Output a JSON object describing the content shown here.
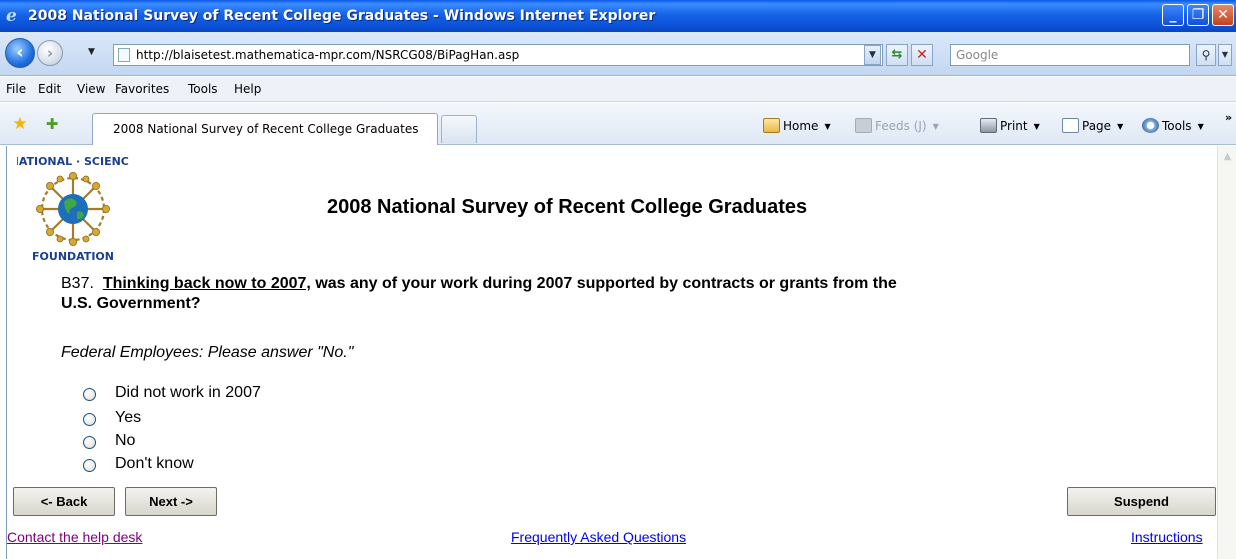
{
  "window": {
    "title": "2008 National Survey of Recent College Graduates - Windows Internet Explorer",
    "controls": {
      "minimize": "_",
      "maximize": "❐",
      "close": "✕"
    }
  },
  "address_bar": {
    "url": "http://blaisetest.mathematica-mpr.com/NSRCG08/BiPagHan.asp",
    "search_placeholder": "Google"
  },
  "menu": {
    "items": [
      "File",
      "Edit",
      "View",
      "Favorites",
      "Tools",
      "Help"
    ]
  },
  "tabs": {
    "active_label": "2008 National Survey of Recent College Graduates"
  },
  "command_bar": {
    "home": "Home",
    "feeds": "Feeds (J)",
    "print": "Print",
    "page": "Page",
    "tools": "Tools"
  },
  "page": {
    "logo_text_top": "NATIONAL · SCIENCE",
    "logo_text_bottom": "FOUNDATION",
    "survey_title": "2008 National Survey of Recent College Graduates",
    "question": {
      "number": "B37.",
      "emphasis": "Thinking back now to 2007,",
      "text": "was any of your work during 2007 supported by contracts or grants from the U.S. Government?"
    },
    "instruction": "Federal Employees: Please answer \"No.\"",
    "options": [
      "Did not work in 2007",
      "Yes",
      "No",
      "Don't know"
    ],
    "buttons": {
      "back": "<- Back",
      "next": "Next ->",
      "suspend": "Suspend"
    },
    "links": {
      "help": "Contact the help desk",
      "faq": "Frequently Asked Questions",
      "instructions": "Instructions"
    }
  },
  "colors": {
    "titlebar": "#1663e8",
    "visited_link": "#800080",
    "link": "#0000ee"
  }
}
